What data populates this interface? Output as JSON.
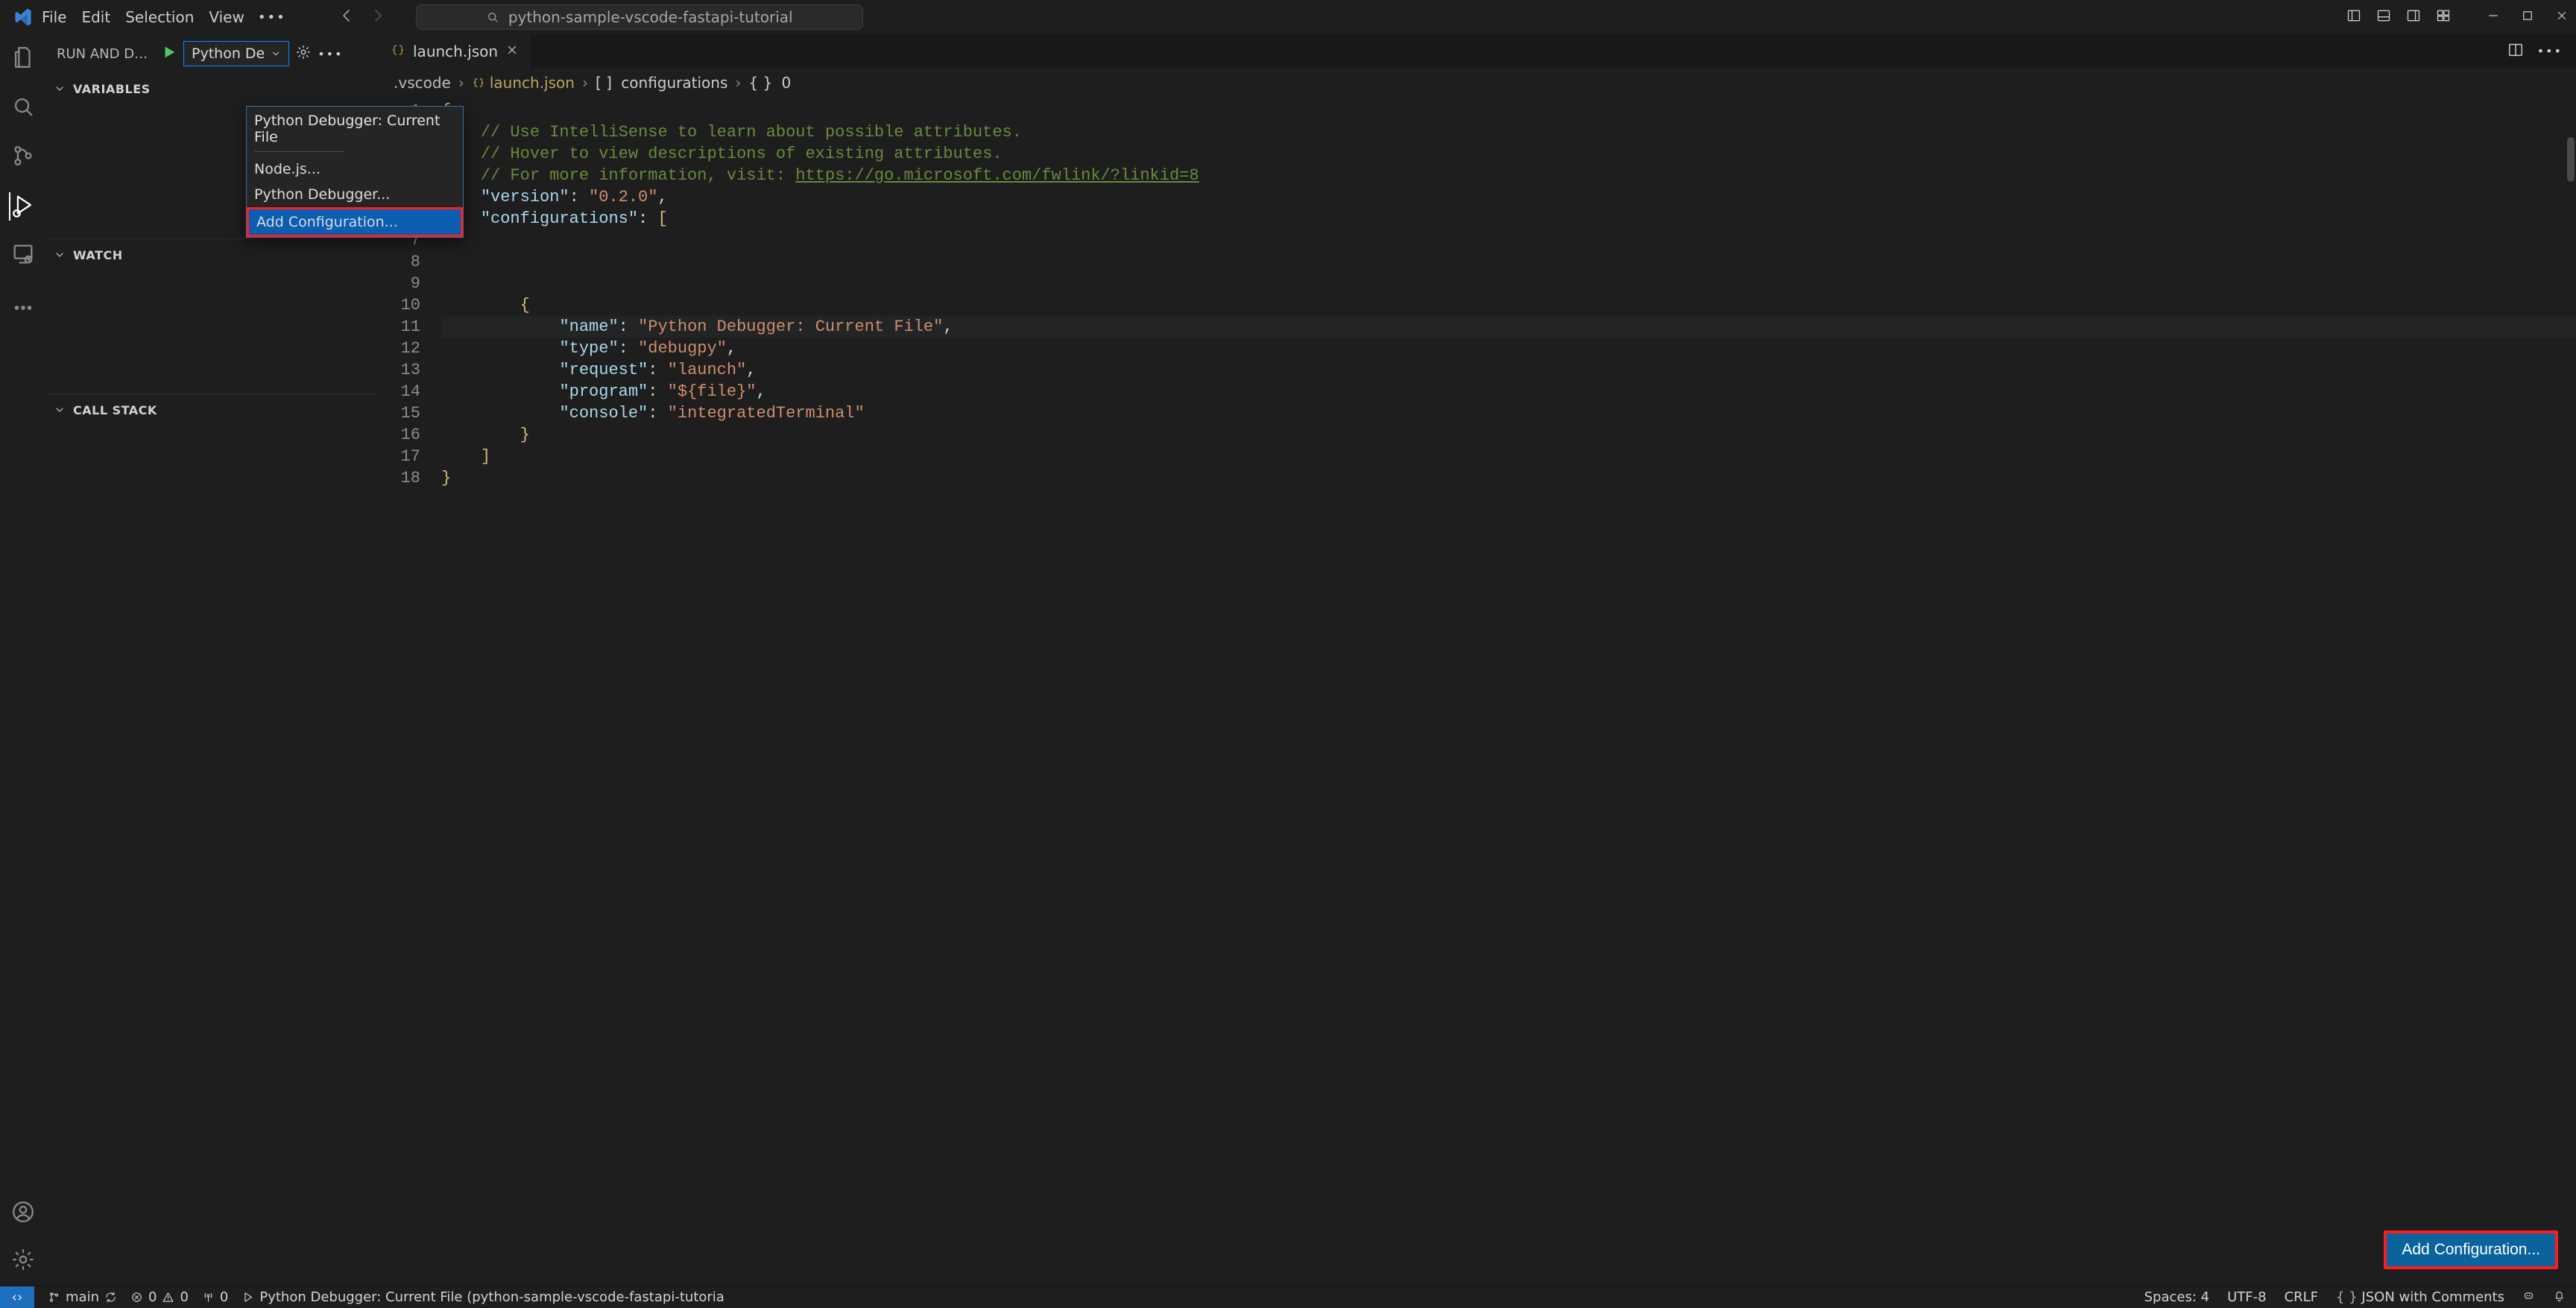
{
  "menu": {
    "file": "File",
    "edit": "Edit",
    "selection": "Selection",
    "view": "View"
  },
  "command_center": {
    "text": "python-sample-vscode-fastapi-tutorial"
  },
  "run_debug": {
    "panel_title": "RUN AND DE...",
    "selected_config": "Python De",
    "sections": {
      "variables": "VARIABLES",
      "watch": "WATCH",
      "callstack": "CALL STACK"
    },
    "dropdown": {
      "group_title": "Python Debugger: Current File",
      "items": [
        "Node.js...",
        "Python Debugger...",
        "Add Configuration..."
      ],
      "highlight_index": 2
    }
  },
  "tabs": {
    "active_name": "launch.json"
  },
  "breadcrumbs": {
    "folder": ".vscode",
    "file": "launch.json",
    "array": "configurations",
    "index": "0"
  },
  "code": {
    "lines": [
      "{",
      "    // Use IntelliSense to learn about possible attributes.",
      "    // Hover to view descriptions of existing attributes.",
      "    // For more information, visit: https://go.microsoft.com/fwlink/?linkid=8",
      "    \"version\": \"0.2.0\",",
      "    \"configurations\": [",
      "",
      "",
      "",
      "        {",
      "            \"name\": \"Python Debugger: Current File\",",
      "            \"type\": \"debugpy\",",
      "            \"request\": \"launch\",",
      "            \"program\": \"${file}\",",
      "            \"console\": \"integratedTerminal\"",
      "        }",
      "    ]",
      "}"
    ],
    "highlight_line": 11
  },
  "add_config_button": "Add Configuration...",
  "status": {
    "branch": "main",
    "errors": "0",
    "warnings": "0",
    "ports": "0",
    "debug_target": "Python Debugger: Current File (python-sample-vscode-fastapi-tutoria",
    "spaces": "Spaces: 4",
    "encoding": "UTF-8",
    "eol": "CRLF",
    "lang": "JSON with Comments"
  }
}
